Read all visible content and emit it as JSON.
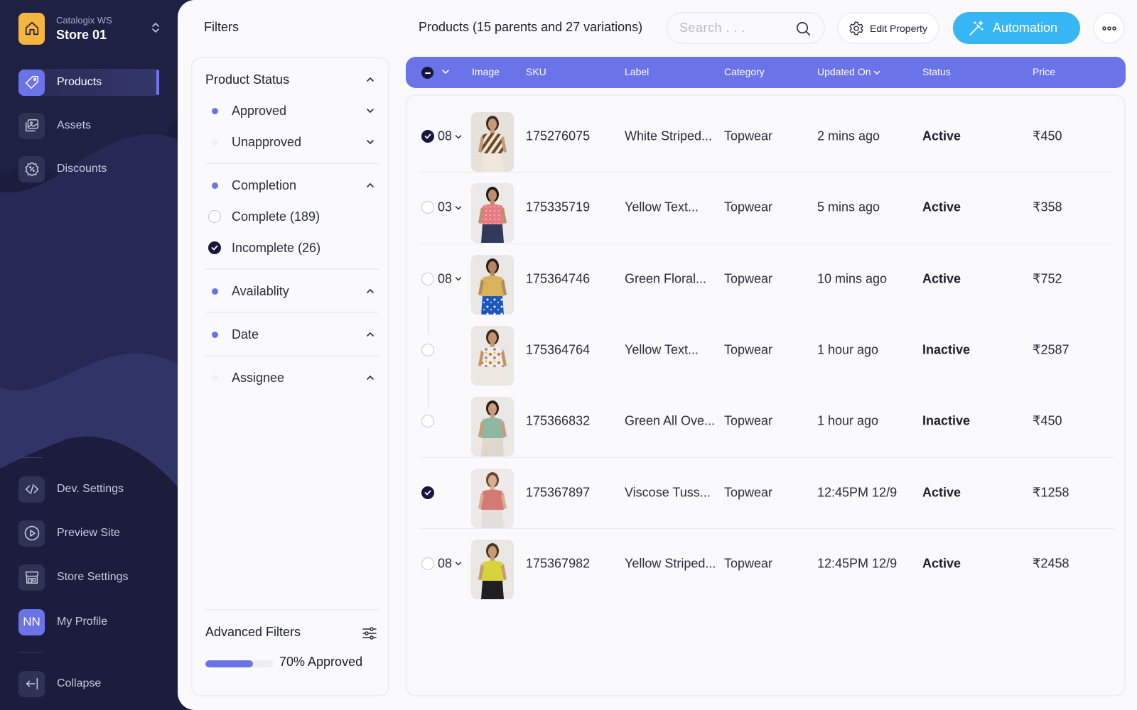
{
  "sidebar": {
    "store_ws": "Catalogix WS",
    "store_name": "Store 01",
    "nav_top": [
      {
        "label": "Products",
        "icon": "tag-icon",
        "active": true
      },
      {
        "label": "Assets",
        "icon": "images-icon",
        "active": false
      },
      {
        "label": "Discounts",
        "icon": "discount-badge-icon",
        "active": false
      }
    ],
    "nav_bottom": [
      {
        "label": "Dev. Settings",
        "icon": "code-icon"
      },
      {
        "label": "Preview Site",
        "icon": "play-icon"
      },
      {
        "label": "Store Settings",
        "icon": "store-icon"
      },
      {
        "label": "My Profile",
        "avatar": "NN"
      }
    ],
    "collapse_label": "Collapse"
  },
  "filters": {
    "title": "Filters",
    "product_status": {
      "label": "Product Status",
      "options": [
        "Approved",
        "Unapproved"
      ]
    },
    "completion": {
      "label": "Completion",
      "options": [
        {
          "label": "Complete (189)",
          "checked": false
        },
        {
          "label": "Incomplete (26)",
          "checked": true
        }
      ]
    },
    "availability": {
      "label": "Availablity"
    },
    "date": {
      "label": "Date"
    },
    "assignee": {
      "label": "Assignee"
    },
    "advanced": "Advanced Filters",
    "approved_fraction": 0.7,
    "approved_text": "70% Approved"
  },
  "header": {
    "products_title": "Products (15 parents and 27 variations)",
    "search_placeholder": "Search . . .",
    "edit_property": "Edit Property",
    "automation": "Automation"
  },
  "table": {
    "columns": {
      "image": "Image",
      "sku": "SKU",
      "label": "Label",
      "category": "Category",
      "updated": "Updated On",
      "status": "Status",
      "price": "Price"
    },
    "rows": [
      {
        "checked": true,
        "variants": "08",
        "sku": "175276075",
        "label": "White Striped...",
        "category": "Topwear",
        "updated": "2 mins ago",
        "status": "Active",
        "price": "₹450",
        "img": "striped-top"
      },
      {
        "checked": false,
        "variants": "03",
        "sku": "175335719",
        "label": "Yellow Text...",
        "category": "Topwear",
        "updated": "5 mins ago",
        "status": "Active",
        "price": "₹358",
        "img": "pink-blouse"
      },
      {
        "checked": false,
        "variants": "08",
        "sku": "175364746",
        "label": "Green Floral...",
        "category": "Topwear",
        "updated": "10 mins ago",
        "status": "Active",
        "price": "₹752",
        "img": "floral-skirt"
      },
      {
        "checked": false,
        "variants": "",
        "sku": "175364764",
        "label": "Yellow Text...",
        "category": "Topwear",
        "updated": "1 hour ago",
        "status": "Inactive",
        "price": "₹2587",
        "img": "printed-shirt"
      },
      {
        "checked": false,
        "variants": "",
        "sku": "175366832",
        "label": "Green All Ove...",
        "category": "Topwear",
        "updated": "1 hour ago",
        "status": "Inactive",
        "price": "₹450",
        "img": "green-top"
      },
      {
        "checked": true,
        "variants": "",
        "sku": "175367897",
        "label": "Viscose Tuss...",
        "category": "Topwear",
        "updated": "12:45PM  12/9",
        "status": "Active",
        "price": "₹1258",
        "img": "rose-top"
      },
      {
        "checked": false,
        "variants": "08",
        "sku": "175367982",
        "label": "Yellow Striped...",
        "category": "Topwear",
        "updated": "12:45PM  12/9",
        "status": "Active",
        "price": "₹2458",
        "img": "yellow-top"
      }
    ]
  },
  "colors": {
    "accent": "#6a73e8",
    "automation": "#37b6f6",
    "sidebar": "#1c1d3d",
    "store_logo": "#f6b53e"
  }
}
